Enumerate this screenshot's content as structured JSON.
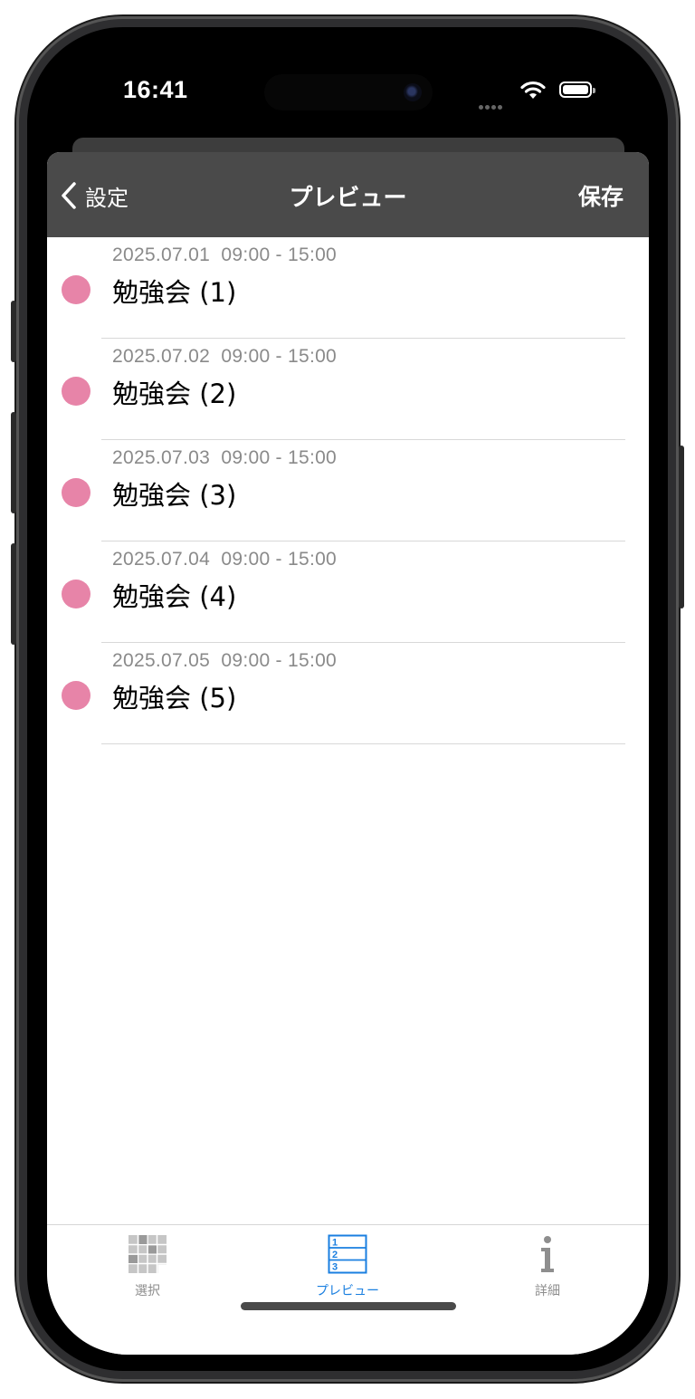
{
  "status": {
    "time": "16:41"
  },
  "nav": {
    "back_label": "設定",
    "title": "プレビュー",
    "save_label": "保存"
  },
  "events": [
    {
      "date": "2025.07.01  09:00 - 15:00",
      "title": "勉強会 (1)",
      "color": "#e784a8"
    },
    {
      "date": "2025.07.02  09:00 - 15:00",
      "title": "勉強会 (2)",
      "color": "#e784a8"
    },
    {
      "date": "2025.07.03  09:00 - 15:00",
      "title": "勉強会 (3)",
      "color": "#e784a8"
    },
    {
      "date": "2025.07.04  09:00 - 15:00",
      "title": "勉強会 (4)",
      "color": "#e784a8"
    },
    {
      "date": "2025.07.05  09:00 - 15:00",
      "title": "勉強会 (5)",
      "color": "#e784a8"
    }
  ],
  "tabs": [
    {
      "label": "選択",
      "icon": "grid-icon",
      "active": false
    },
    {
      "label": "プレビュー",
      "icon": "numbered-list-icon",
      "active": true
    },
    {
      "label": "詳細",
      "icon": "info-icon",
      "active": false
    }
  ],
  "colors": {
    "navbar": "#4a4a4a",
    "accent": "#1a7fe0",
    "event_dot": "#e784a8"
  }
}
